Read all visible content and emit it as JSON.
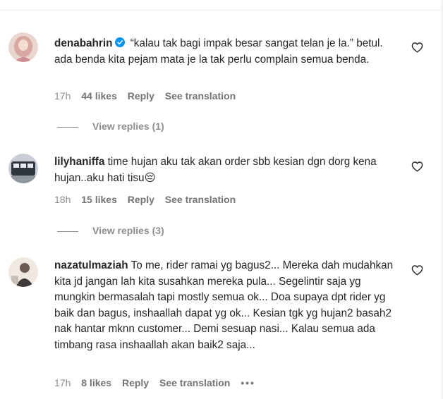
{
  "comments": [
    {
      "username": "denabahrin",
      "verified": true,
      "text": "“kalau tak bagi impak besar sangat telan je la.” betul. ada benda kita pejam mata je la tak perlu complain semua benda.",
      "time": "17h",
      "likes": "44 likes",
      "reply": "Reply",
      "translation": "See translation",
      "view_replies": "View replies (1)"
    },
    {
      "username": "lilyhaniffa",
      "verified": false,
      "text": "time hujan aku tak akan order sbb kesian dgn dorg kena hujan..aku hati tisu😔",
      "time": "18h",
      "likes": "15 likes",
      "reply": "Reply",
      "translation": "See translation",
      "view_replies": "View replies (3)"
    },
    {
      "username": "nazatulmaziah",
      "verified": false,
      "text": "To me, rider ramai yg bagus2... Mereka dah mudahkan kita jd jangan lah kita susahkan mereka pula... Segelintir saja yg mungkin bermasalah tapi mostly semua ok... Doa supaya dpt rider yg baik dan bagus, inshaallah dapat yg ok... Kesian tgk yg hujan2 basah2 nak hantar mknn customer... Demi sesuap nasi... Kalau semua ada timbang rasa inshaallah akan baik2 saja...",
      "time": "17h",
      "likes": "8 likes",
      "reply": "Reply",
      "translation": "See translation",
      "more": "•••"
    }
  ],
  "colors": {
    "text": "#262626",
    "secondary": "#8e8e8e",
    "verified": "#0095f6"
  },
  "icons": [
    "verified-badge-icon",
    "heart-icon",
    "more-options-icon"
  ]
}
